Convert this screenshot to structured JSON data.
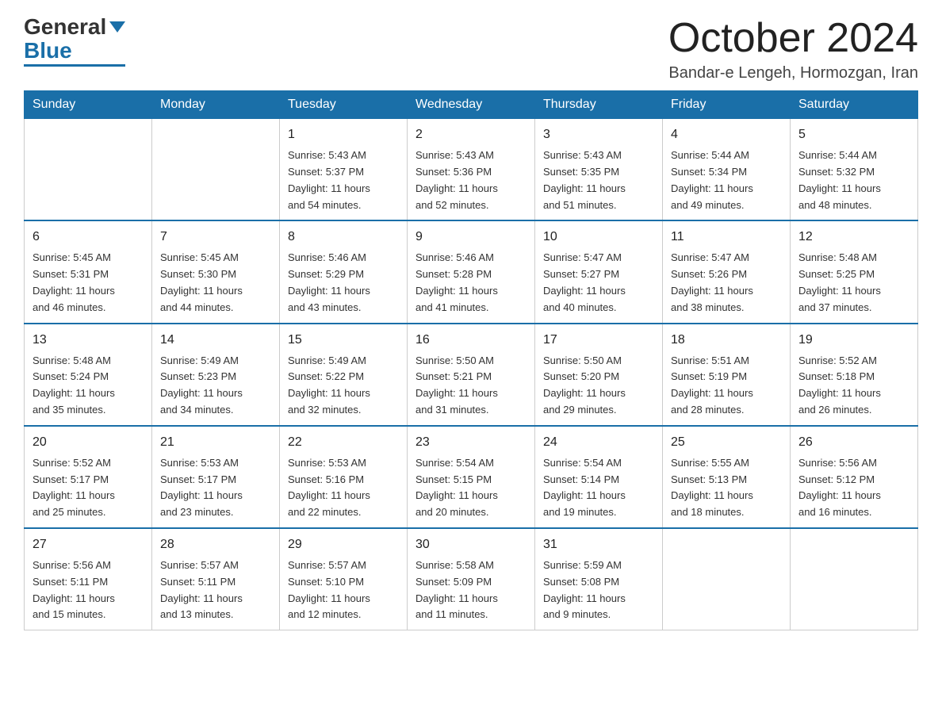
{
  "header": {
    "logo_general": "General",
    "logo_blue": "Blue",
    "month_title": "October 2024",
    "location": "Bandar-e Lengeh, Hormozgan, Iran"
  },
  "weekdays": [
    "Sunday",
    "Monday",
    "Tuesday",
    "Wednesday",
    "Thursday",
    "Friday",
    "Saturday"
  ],
  "weeks": [
    [
      {
        "day": "",
        "info": ""
      },
      {
        "day": "",
        "info": ""
      },
      {
        "day": "1",
        "info": "Sunrise: 5:43 AM\nSunset: 5:37 PM\nDaylight: 11 hours\nand 54 minutes."
      },
      {
        "day": "2",
        "info": "Sunrise: 5:43 AM\nSunset: 5:36 PM\nDaylight: 11 hours\nand 52 minutes."
      },
      {
        "day": "3",
        "info": "Sunrise: 5:43 AM\nSunset: 5:35 PM\nDaylight: 11 hours\nand 51 minutes."
      },
      {
        "day": "4",
        "info": "Sunrise: 5:44 AM\nSunset: 5:34 PM\nDaylight: 11 hours\nand 49 minutes."
      },
      {
        "day": "5",
        "info": "Sunrise: 5:44 AM\nSunset: 5:32 PM\nDaylight: 11 hours\nand 48 minutes."
      }
    ],
    [
      {
        "day": "6",
        "info": "Sunrise: 5:45 AM\nSunset: 5:31 PM\nDaylight: 11 hours\nand 46 minutes."
      },
      {
        "day": "7",
        "info": "Sunrise: 5:45 AM\nSunset: 5:30 PM\nDaylight: 11 hours\nand 44 minutes."
      },
      {
        "day": "8",
        "info": "Sunrise: 5:46 AM\nSunset: 5:29 PM\nDaylight: 11 hours\nand 43 minutes."
      },
      {
        "day": "9",
        "info": "Sunrise: 5:46 AM\nSunset: 5:28 PM\nDaylight: 11 hours\nand 41 minutes."
      },
      {
        "day": "10",
        "info": "Sunrise: 5:47 AM\nSunset: 5:27 PM\nDaylight: 11 hours\nand 40 minutes."
      },
      {
        "day": "11",
        "info": "Sunrise: 5:47 AM\nSunset: 5:26 PM\nDaylight: 11 hours\nand 38 minutes."
      },
      {
        "day": "12",
        "info": "Sunrise: 5:48 AM\nSunset: 5:25 PM\nDaylight: 11 hours\nand 37 minutes."
      }
    ],
    [
      {
        "day": "13",
        "info": "Sunrise: 5:48 AM\nSunset: 5:24 PM\nDaylight: 11 hours\nand 35 minutes."
      },
      {
        "day": "14",
        "info": "Sunrise: 5:49 AM\nSunset: 5:23 PM\nDaylight: 11 hours\nand 34 minutes."
      },
      {
        "day": "15",
        "info": "Sunrise: 5:49 AM\nSunset: 5:22 PM\nDaylight: 11 hours\nand 32 minutes."
      },
      {
        "day": "16",
        "info": "Sunrise: 5:50 AM\nSunset: 5:21 PM\nDaylight: 11 hours\nand 31 minutes."
      },
      {
        "day": "17",
        "info": "Sunrise: 5:50 AM\nSunset: 5:20 PM\nDaylight: 11 hours\nand 29 minutes."
      },
      {
        "day": "18",
        "info": "Sunrise: 5:51 AM\nSunset: 5:19 PM\nDaylight: 11 hours\nand 28 minutes."
      },
      {
        "day": "19",
        "info": "Sunrise: 5:52 AM\nSunset: 5:18 PM\nDaylight: 11 hours\nand 26 minutes."
      }
    ],
    [
      {
        "day": "20",
        "info": "Sunrise: 5:52 AM\nSunset: 5:17 PM\nDaylight: 11 hours\nand 25 minutes."
      },
      {
        "day": "21",
        "info": "Sunrise: 5:53 AM\nSunset: 5:17 PM\nDaylight: 11 hours\nand 23 minutes."
      },
      {
        "day": "22",
        "info": "Sunrise: 5:53 AM\nSunset: 5:16 PM\nDaylight: 11 hours\nand 22 minutes."
      },
      {
        "day": "23",
        "info": "Sunrise: 5:54 AM\nSunset: 5:15 PM\nDaylight: 11 hours\nand 20 minutes."
      },
      {
        "day": "24",
        "info": "Sunrise: 5:54 AM\nSunset: 5:14 PM\nDaylight: 11 hours\nand 19 minutes."
      },
      {
        "day": "25",
        "info": "Sunrise: 5:55 AM\nSunset: 5:13 PM\nDaylight: 11 hours\nand 18 minutes."
      },
      {
        "day": "26",
        "info": "Sunrise: 5:56 AM\nSunset: 5:12 PM\nDaylight: 11 hours\nand 16 minutes."
      }
    ],
    [
      {
        "day": "27",
        "info": "Sunrise: 5:56 AM\nSunset: 5:11 PM\nDaylight: 11 hours\nand 15 minutes."
      },
      {
        "day": "28",
        "info": "Sunrise: 5:57 AM\nSunset: 5:11 PM\nDaylight: 11 hours\nand 13 minutes."
      },
      {
        "day": "29",
        "info": "Sunrise: 5:57 AM\nSunset: 5:10 PM\nDaylight: 11 hours\nand 12 minutes."
      },
      {
        "day": "30",
        "info": "Sunrise: 5:58 AM\nSunset: 5:09 PM\nDaylight: 11 hours\nand 11 minutes."
      },
      {
        "day": "31",
        "info": "Sunrise: 5:59 AM\nSunset: 5:08 PM\nDaylight: 11 hours\nand 9 minutes."
      },
      {
        "day": "",
        "info": ""
      },
      {
        "day": "",
        "info": ""
      }
    ]
  ]
}
